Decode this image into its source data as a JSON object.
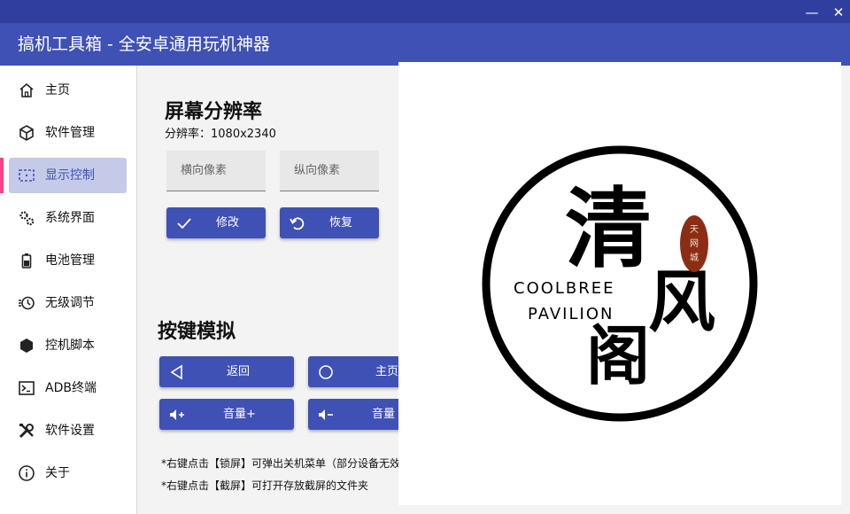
{
  "window": {
    "title": "搞机工具箱 - 全安卓通用玩机神器",
    "minimize_glyph": "—",
    "close_glyph": "✕"
  },
  "sidebar": {
    "items": [
      {
        "label": "主页",
        "icon": "home-icon"
      },
      {
        "label": "软件管理",
        "icon": "package-icon"
      },
      {
        "label": "显示控制",
        "icon": "screen-icon",
        "active": true
      },
      {
        "label": "系统界面",
        "icon": "gears-icon"
      },
      {
        "label": "电池管理",
        "icon": "battery-icon"
      },
      {
        "label": "无级调节",
        "icon": "timer-icon"
      },
      {
        "label": "控机脚本",
        "icon": "hexagon-icon"
      },
      {
        "label": "ADB终端",
        "icon": "terminal-icon"
      },
      {
        "label": "软件设置",
        "icon": "tools-icon"
      },
      {
        "label": "关于",
        "icon": "info-icon"
      }
    ]
  },
  "resolution": {
    "heading": "屏幕分辨率",
    "current": "分辨率：1080x2340",
    "width_placeholder": "横向像素",
    "height_placeholder": "纵向像素",
    "apply_label": "修改",
    "restore_label": "恢复"
  },
  "keys": {
    "heading": "按键模拟",
    "back_label": "返回",
    "home_label": "主页",
    "vol_up_label": "音量+",
    "vol_down_label": "音量"
  },
  "notes": [
    "*右键点击【锁屏】可弹出关机菜单（部分设备无效",
    "*右键点击【截屏】可打开存放截屏的文件夹"
  ],
  "logo": {
    "char1": "清",
    "char2": "风",
    "char3": "阁",
    "english_line1": "COOLBREE",
    "english_line2": "PAVILION",
    "seal_text": "天网城",
    "seal_color": "#8b2d14"
  },
  "colors": {
    "accent": "#3f51b5",
    "accent_dark": "#303f9f",
    "active_bg": "#c5cae9",
    "indicator": "#ff4081"
  }
}
